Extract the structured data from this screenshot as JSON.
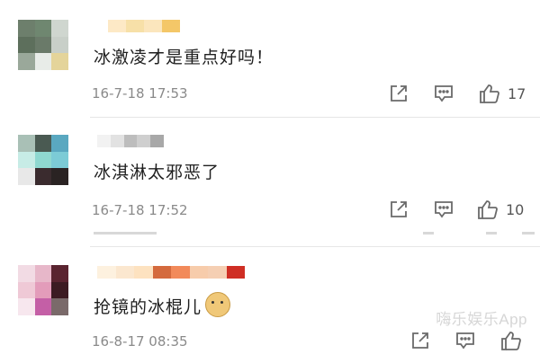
{
  "comments": [
    {
      "text": "冰激凌才是重点好吗！",
      "time": "16-7-18 17:53",
      "likes": "17",
      "avatar_colors": [
        "#6d7f6c",
        "#6f8770",
        "#cfd6cf",
        "#5d6f5c",
        "#6a7a69",
        "#c8cfc8",
        "#9aa89a",
        "#e8ece8",
        "#e4d49a"
      ],
      "name_colors": [
        "#ffffff",
        "#fde9c6",
        "#f7e0a8",
        "#fbe6bd",
        "#f4c768"
      ]
    },
    {
      "text": "冰淇淋太邪恶了",
      "time": "16-7-18 17:52",
      "likes": "10",
      "avatar_colors": [
        "#a9c0b6",
        "#4a5a52",
        "#5aa8c0",
        "#c7ece6",
        "#8fd8d0",
        "#7ccbd6",
        "#e8e8e8",
        "#3a2b2e",
        "#2a2323"
      ],
      "name_colors": [
        "#f2f2f2",
        "#e2e2e2",
        "#bdbdbd",
        "#cfcfcf",
        "#a8a8a8"
      ]
    },
    {
      "text": "抢镜的冰棍儿",
      "time": "16-8-17 08:35",
      "likes": "",
      "avatar_colors": [
        "#f2dbe4",
        "#e7b7c9",
        "#5a2430",
        "#efc9d6",
        "#e39cba",
        "#3c1b22",
        "#f7e7ee",
        "#c45fa6",
        "#7a6a6a"
      ],
      "name_colors": [
        "#fdf1df",
        "#fbe7cf",
        "#fde2c0",
        "#d46a3d",
        "#f28a5a",
        "#f7ccab",
        "#f5cfb3",
        "#cf2e24"
      ]
    }
  ],
  "icons": {
    "share": "share-icon",
    "comment": "comment-icon",
    "like": "thumbs-up-icon"
  },
  "watermark": "嗨乐娱乐App"
}
